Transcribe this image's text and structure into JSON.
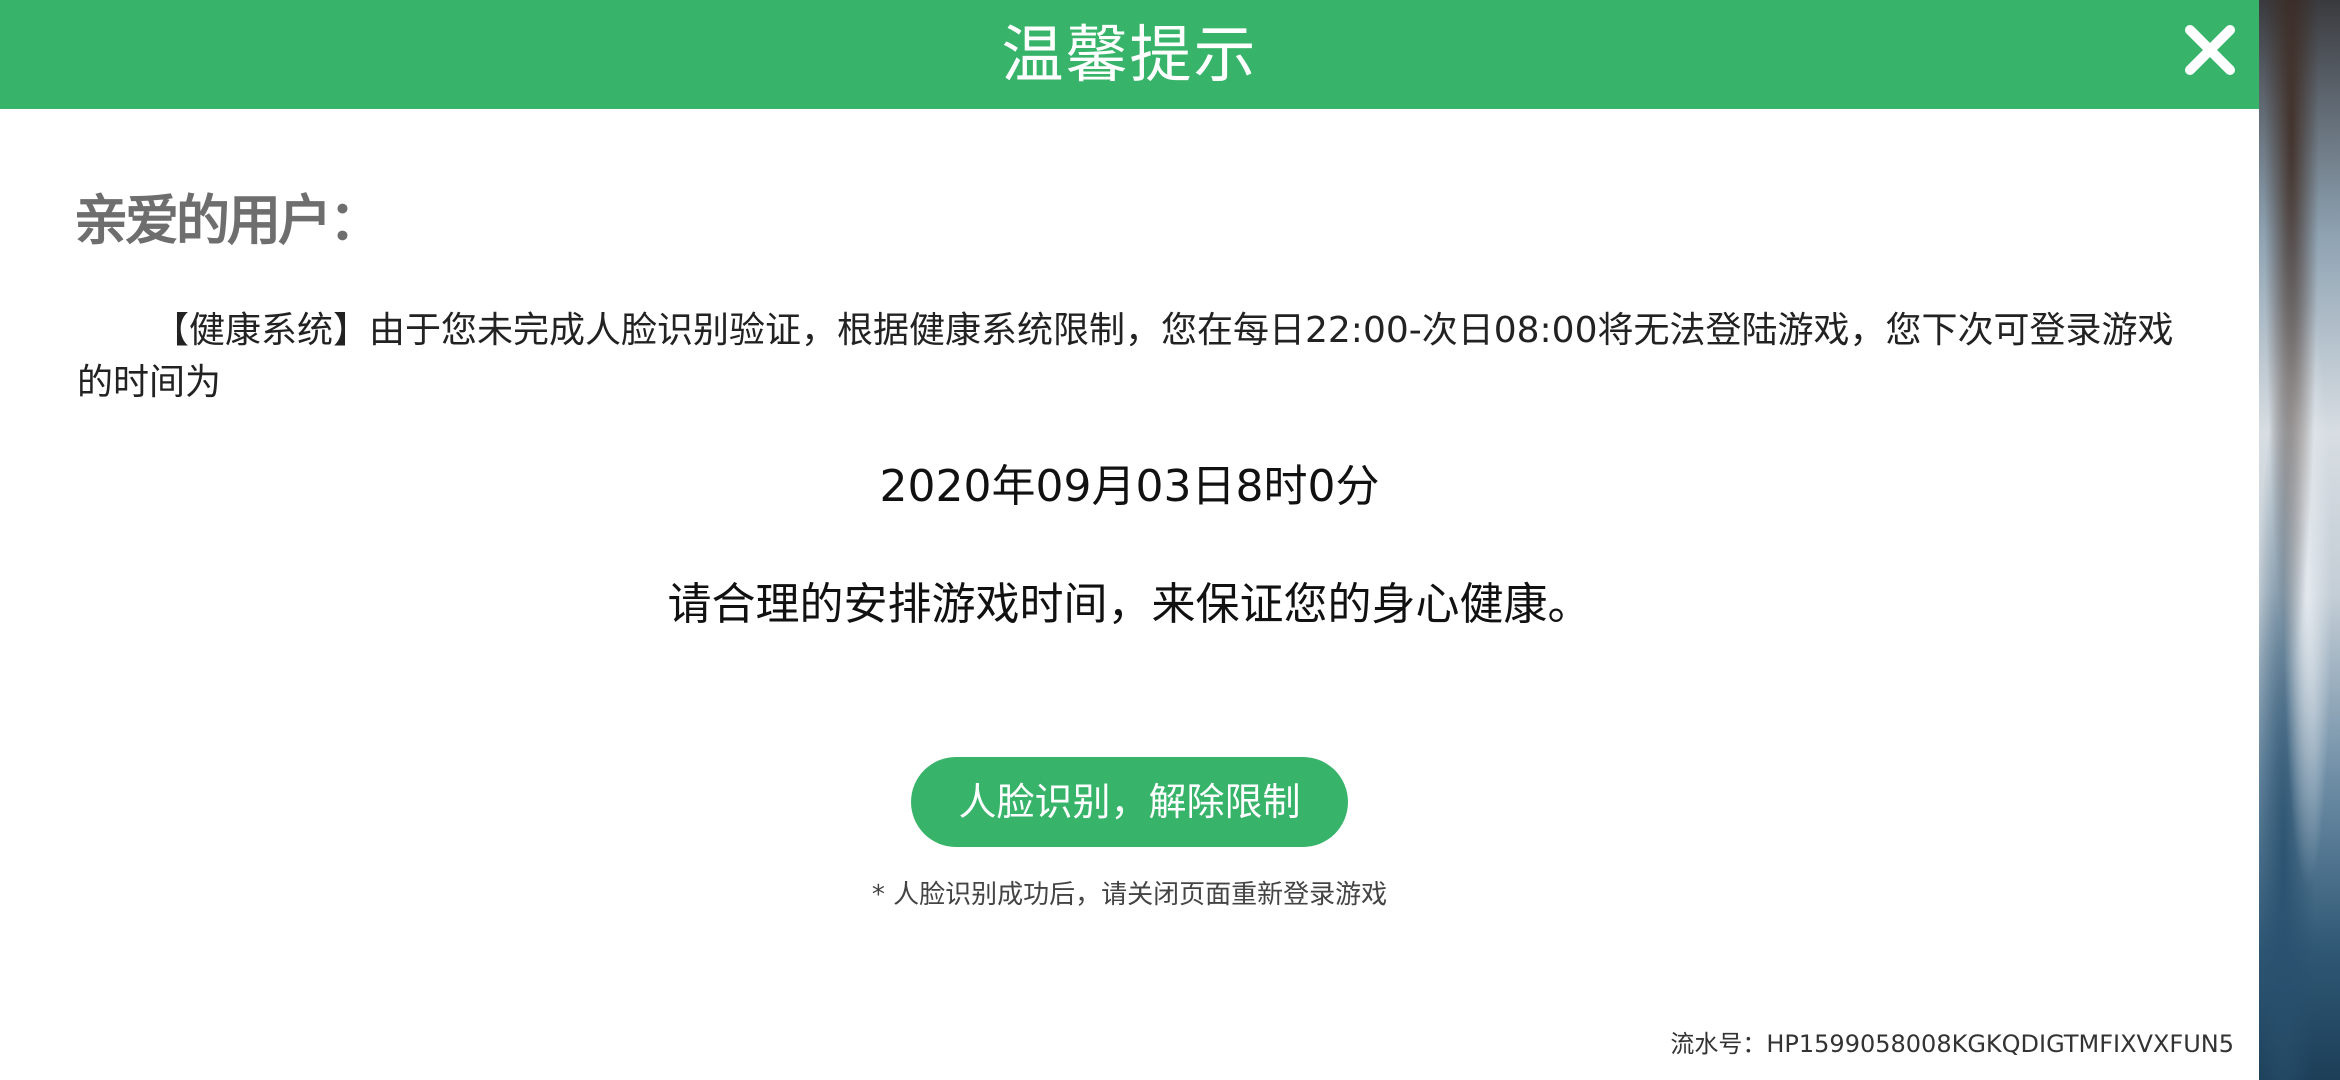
{
  "dialog": {
    "title": "温馨提示",
    "greeting": "亲爱的用户：",
    "message": "【健康系统】由于您未完成人脸识别验证，根据健康系统限制，您在每日22:00-次日08:00将无法登陆游戏，您下次可登录游戏的时间为",
    "next_login_time": "2020年09月03日8时0分",
    "advice": "请合理的安排游戏时间，来保证您的身心健康。",
    "primary_button_label": "人脸识别，解除限制",
    "note": "* 人脸识别成功后，请关闭页面重新登录游戏",
    "serial": "流水号：HP1599058008KGKQDIGTMFIXVXFUN5",
    "close_icon": "close-icon"
  },
  "colors": {
    "accent": "#37b46a",
    "greeting_text": "#6e6e6e"
  }
}
